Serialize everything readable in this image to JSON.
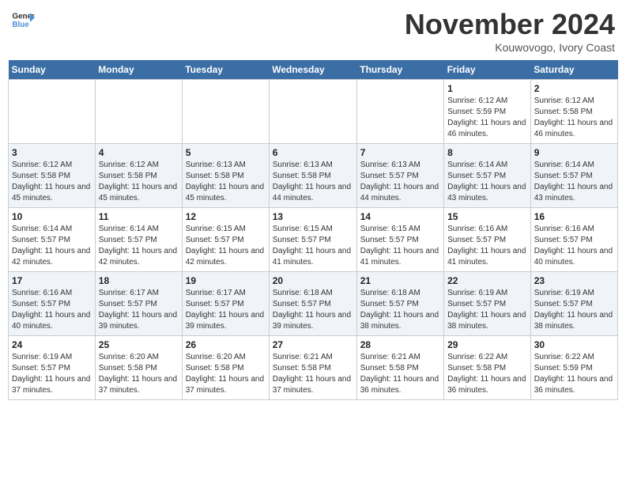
{
  "logo": {
    "line1": "General",
    "line2": "Blue"
  },
  "header": {
    "month": "November 2024",
    "location": "Kouwovogo, Ivory Coast"
  },
  "weekdays": [
    "Sunday",
    "Monday",
    "Tuesday",
    "Wednesday",
    "Thursday",
    "Friday",
    "Saturday"
  ],
  "weeks": [
    [
      {
        "day": "",
        "info": ""
      },
      {
        "day": "",
        "info": ""
      },
      {
        "day": "",
        "info": ""
      },
      {
        "day": "",
        "info": ""
      },
      {
        "day": "",
        "info": ""
      },
      {
        "day": "1",
        "info": "Sunrise: 6:12 AM\nSunset: 5:59 PM\nDaylight: 11 hours and 46 minutes."
      },
      {
        "day": "2",
        "info": "Sunrise: 6:12 AM\nSunset: 5:58 PM\nDaylight: 11 hours and 46 minutes."
      }
    ],
    [
      {
        "day": "3",
        "info": "Sunrise: 6:12 AM\nSunset: 5:58 PM\nDaylight: 11 hours and 45 minutes."
      },
      {
        "day": "4",
        "info": "Sunrise: 6:12 AM\nSunset: 5:58 PM\nDaylight: 11 hours and 45 minutes."
      },
      {
        "day": "5",
        "info": "Sunrise: 6:13 AM\nSunset: 5:58 PM\nDaylight: 11 hours and 45 minutes."
      },
      {
        "day": "6",
        "info": "Sunrise: 6:13 AM\nSunset: 5:58 PM\nDaylight: 11 hours and 44 minutes."
      },
      {
        "day": "7",
        "info": "Sunrise: 6:13 AM\nSunset: 5:57 PM\nDaylight: 11 hours and 44 minutes."
      },
      {
        "day": "8",
        "info": "Sunrise: 6:14 AM\nSunset: 5:57 PM\nDaylight: 11 hours and 43 minutes."
      },
      {
        "day": "9",
        "info": "Sunrise: 6:14 AM\nSunset: 5:57 PM\nDaylight: 11 hours and 43 minutes."
      }
    ],
    [
      {
        "day": "10",
        "info": "Sunrise: 6:14 AM\nSunset: 5:57 PM\nDaylight: 11 hours and 42 minutes."
      },
      {
        "day": "11",
        "info": "Sunrise: 6:14 AM\nSunset: 5:57 PM\nDaylight: 11 hours and 42 minutes."
      },
      {
        "day": "12",
        "info": "Sunrise: 6:15 AM\nSunset: 5:57 PM\nDaylight: 11 hours and 42 minutes."
      },
      {
        "day": "13",
        "info": "Sunrise: 6:15 AM\nSunset: 5:57 PM\nDaylight: 11 hours and 41 minutes."
      },
      {
        "day": "14",
        "info": "Sunrise: 6:15 AM\nSunset: 5:57 PM\nDaylight: 11 hours and 41 minutes."
      },
      {
        "day": "15",
        "info": "Sunrise: 6:16 AM\nSunset: 5:57 PM\nDaylight: 11 hours and 41 minutes."
      },
      {
        "day": "16",
        "info": "Sunrise: 6:16 AM\nSunset: 5:57 PM\nDaylight: 11 hours and 40 minutes."
      }
    ],
    [
      {
        "day": "17",
        "info": "Sunrise: 6:16 AM\nSunset: 5:57 PM\nDaylight: 11 hours and 40 minutes."
      },
      {
        "day": "18",
        "info": "Sunrise: 6:17 AM\nSunset: 5:57 PM\nDaylight: 11 hours and 39 minutes."
      },
      {
        "day": "19",
        "info": "Sunrise: 6:17 AM\nSunset: 5:57 PM\nDaylight: 11 hours and 39 minutes."
      },
      {
        "day": "20",
        "info": "Sunrise: 6:18 AM\nSunset: 5:57 PM\nDaylight: 11 hours and 39 minutes."
      },
      {
        "day": "21",
        "info": "Sunrise: 6:18 AM\nSunset: 5:57 PM\nDaylight: 11 hours and 38 minutes."
      },
      {
        "day": "22",
        "info": "Sunrise: 6:19 AM\nSunset: 5:57 PM\nDaylight: 11 hours and 38 minutes."
      },
      {
        "day": "23",
        "info": "Sunrise: 6:19 AM\nSunset: 5:57 PM\nDaylight: 11 hours and 38 minutes."
      }
    ],
    [
      {
        "day": "24",
        "info": "Sunrise: 6:19 AM\nSunset: 5:57 PM\nDaylight: 11 hours and 37 minutes."
      },
      {
        "day": "25",
        "info": "Sunrise: 6:20 AM\nSunset: 5:58 PM\nDaylight: 11 hours and 37 minutes."
      },
      {
        "day": "26",
        "info": "Sunrise: 6:20 AM\nSunset: 5:58 PM\nDaylight: 11 hours and 37 minutes."
      },
      {
        "day": "27",
        "info": "Sunrise: 6:21 AM\nSunset: 5:58 PM\nDaylight: 11 hours and 37 minutes."
      },
      {
        "day": "28",
        "info": "Sunrise: 6:21 AM\nSunset: 5:58 PM\nDaylight: 11 hours and 36 minutes."
      },
      {
        "day": "29",
        "info": "Sunrise: 6:22 AM\nSunset: 5:58 PM\nDaylight: 11 hours and 36 minutes."
      },
      {
        "day": "30",
        "info": "Sunrise: 6:22 AM\nSunset: 5:59 PM\nDaylight: 11 hours and 36 minutes."
      }
    ]
  ]
}
